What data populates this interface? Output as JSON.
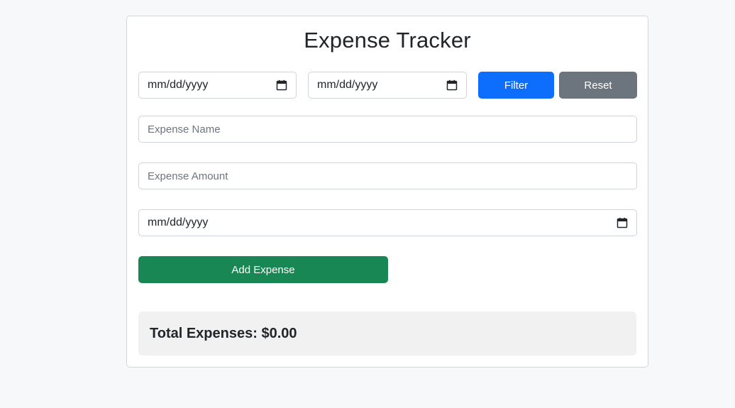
{
  "app": {
    "title": "Expense Tracker"
  },
  "filter": {
    "start_date_value": "mm/dd/yyyy",
    "end_date_value": "mm/dd/yyyy",
    "filter_label": "Filter",
    "reset_label": "Reset"
  },
  "form": {
    "name_placeholder": "Expense Name",
    "amount_placeholder": "Expense Amount",
    "date_value": "mm/dd/yyyy",
    "add_label": "Add Expense"
  },
  "summary": {
    "total_label": "Total Expenses:",
    "total_value": "$0.00"
  },
  "colors": {
    "primary": "#0d6efd",
    "secondary": "#6c757d",
    "success": "#198754",
    "background": "#f7f8fa"
  },
  "icons": {
    "date_picker": "calendar-icon"
  }
}
